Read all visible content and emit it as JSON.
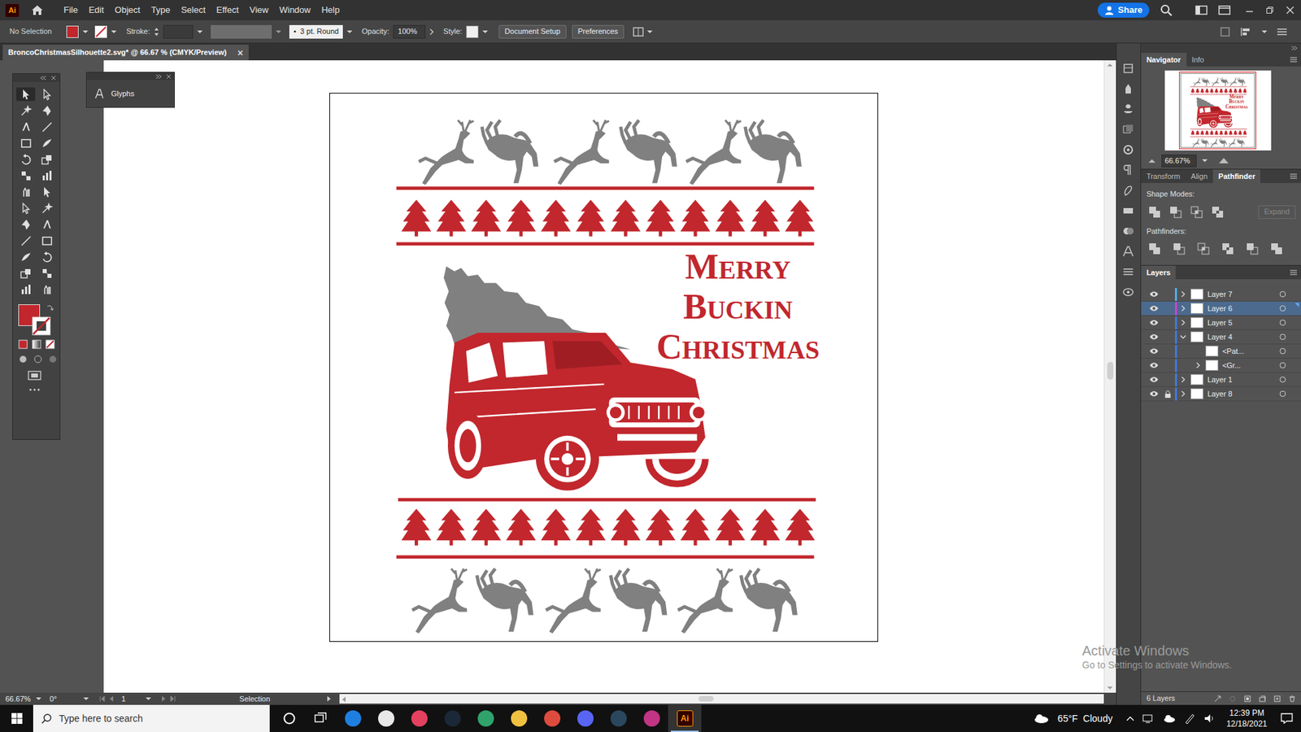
{
  "app": {
    "logo": "Ai"
  },
  "menu": [
    "File",
    "Edit",
    "Object",
    "Type",
    "Select",
    "Effect",
    "View",
    "Window",
    "Help"
  ],
  "share": {
    "label": "Share"
  },
  "control_bar": {
    "selection": "No Selection",
    "fill_color": "#c1272d",
    "stroke_label": "Stroke:",
    "brush_dot": "•",
    "brush": "3 pt. Round",
    "opacity_label": "Opacity:",
    "opacity": "100%",
    "style_label": "Style:",
    "buttons": [
      "Document Setup",
      "Preferences"
    ]
  },
  "document_tab": {
    "title": "BroncoChristmasSilhouette2.svg* @ 66.67 % (CMYK/Preview)",
    "close": "×"
  },
  "toolbar": {
    "tools": [
      {
        "selected": true
      },
      {
        "selected": false
      },
      {
        "selected": false
      },
      {
        "selected": false
      },
      {
        "selected": false
      },
      {
        "selected": false
      },
      {
        "selected": false
      },
      {
        "selected": false
      },
      {
        "selected": false
      },
      {
        "selected": false
      },
      {
        "selected": false
      },
      {
        "selected": false
      },
      {
        "selected": false
      },
      {
        "selected": false
      },
      {
        "selected": false
      },
      {
        "selected": false
      },
      {
        "selected": false
      },
      {
        "selected": false
      },
      {
        "selected": false
      },
      {
        "selected": false
      },
      {
        "selected": false
      },
      {
        "selected": false
      },
      {
        "selected": false
      },
      {
        "selected": false
      },
      {
        "selected": false
      },
      {
        "selected": false
      }
    ]
  },
  "glyphs_panel": {
    "title": "Glyphs"
  },
  "artwork": {
    "lines": [
      "MERRY",
      "BUCKIN",
      "CHRISTMAS"
    ]
  },
  "navigator": {
    "tabs": [
      {
        "label": "Navigator",
        "selected": true
      },
      {
        "label": "Info",
        "selected": false
      }
    ],
    "zoom": "66.67%"
  },
  "properties_tabs": [
    {
      "label": "Transform",
      "selected": false
    },
    {
      "label": "Align",
      "selected": false
    },
    {
      "label": "Pathfinder",
      "selected": true
    }
  ],
  "pathfinder": {
    "shape_modes": "Shape Modes:",
    "expand": "Expand",
    "expand_disabled": true,
    "pathfinders": "Pathfinders:"
  },
  "layers": {
    "title": "Layers",
    "items": [
      {
        "name": "Layer 7",
        "kind": "layer",
        "visible": true,
        "locked": false,
        "expandable": true,
        "expanded": false,
        "selected": false,
        "color": "#4fb0f0"
      },
      {
        "name": "Layer 6",
        "kind": "layer",
        "visible": true,
        "locked": false,
        "expandable": true,
        "expanded": false,
        "selected": true,
        "color": "#d43fd4"
      },
      {
        "name": "Layer 5",
        "kind": "layer",
        "visible": true,
        "locked": false,
        "expandable": true,
        "expanded": false,
        "selected": false,
        "color": "#3d7be0"
      },
      {
        "name": "Layer 4",
        "kind": "layer",
        "visible": true,
        "locked": false,
        "expandable": true,
        "expanded": true,
        "selected": false,
        "color": "#3d7be0"
      },
      {
        "name": "<Pat...",
        "kind": "sublayer",
        "visible": true,
        "locked": false,
        "expandable": false,
        "expanded": false,
        "selected": false,
        "color": "#3d7be0"
      },
      {
        "name": "<Gr...",
        "kind": "sublayer",
        "visible": true,
        "locked": false,
        "expandable": true,
        "expanded": false,
        "selected": false,
        "color": "#3d7be0"
      },
      {
        "name": "Layer 1",
        "kind": "layer",
        "visible": true,
        "locked": false,
        "expandable": true,
        "expanded": false,
        "selected": false,
        "color": "#3d7be0"
      },
      {
        "name": "Layer 8",
        "kind": "layer",
        "visible": true,
        "locked": true,
        "expandable": true,
        "expanded": false,
        "selected": false,
        "color": "#3d7be0"
      }
    ],
    "count": "6 Layers"
  },
  "status_bar": {
    "zoom": "66.67%",
    "rotation": "0°",
    "artboard": "1",
    "tool": "Selection"
  },
  "watermark": {
    "title": "Activate Windows",
    "subtitle": "Go to Settings to activate Windows."
  },
  "taskbar": {
    "search_placeholder": "Type here to search",
    "weather": "65°F  Cloudy",
    "time": "12:39 PM",
    "date": "12/18/2021",
    "apps": [
      {
        "active": false
      },
      {
        "active": false
      },
      {
        "active": false
      },
      {
        "active": false
      },
      {
        "active": false
      },
      {
        "active": false
      },
      {
        "active": false
      },
      {
        "active": false
      },
      {
        "active": false
      },
      {
        "active": false
      },
      {
        "active": true,
        "label": "Ai"
      }
    ]
  }
}
